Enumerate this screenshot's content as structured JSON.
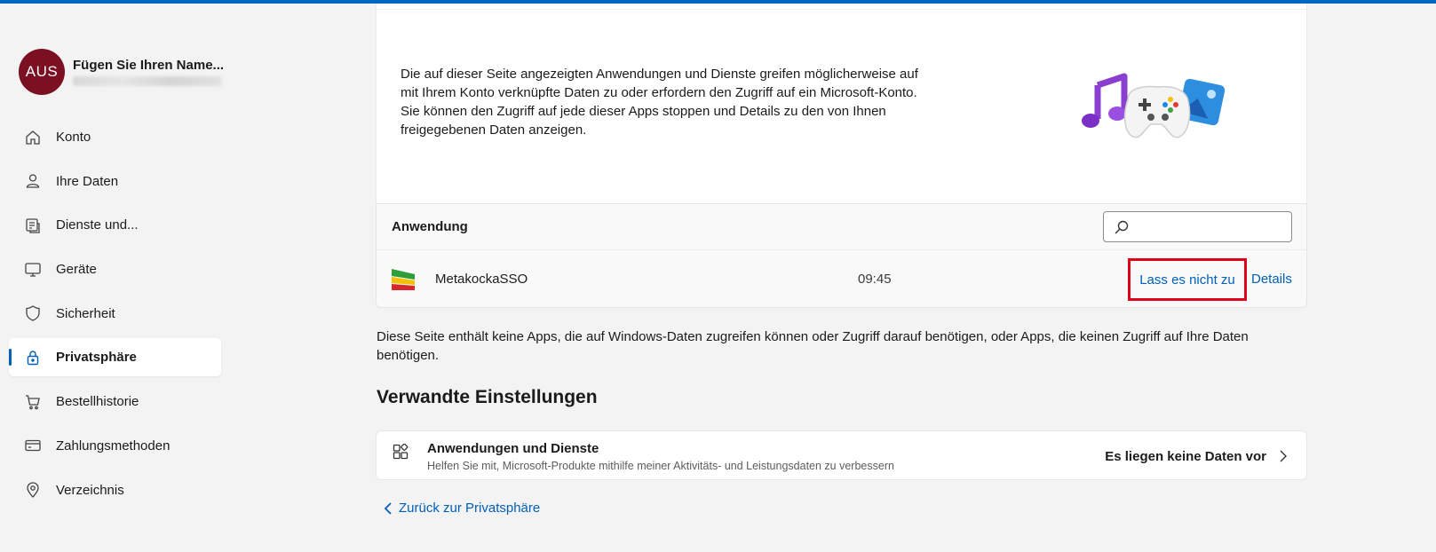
{
  "profile": {
    "initials": "AUS",
    "name": "Fügen Sie Ihren Name..."
  },
  "sidebar": {
    "items": [
      {
        "label": "Konto",
        "icon": "home-icon"
      },
      {
        "label": "Ihre Daten",
        "icon": "person-icon"
      },
      {
        "label": "Dienste und...",
        "icon": "services-icon"
      },
      {
        "label": "Geräte",
        "icon": "monitor-icon"
      },
      {
        "label": "Sicherheit",
        "icon": "shield-icon"
      },
      {
        "label": "Privatsphäre",
        "icon": "lock-icon",
        "active": true
      },
      {
        "label": "Bestellhistorie",
        "icon": "cart-icon"
      },
      {
        "label": "Zahlungsmethoden",
        "icon": "card-icon"
      },
      {
        "label": "Verzeichnis",
        "icon": "location-pin-icon"
      }
    ]
  },
  "main": {
    "intro": "Die auf dieser Seite angezeigten Anwendungen und Dienste greifen möglicherweise auf mit Ihrem Konto verknüpfte Daten zu oder erfordern den Zugriff auf ein Microsoft-Konto. Sie können den Zugriff auf jede dieser Apps stoppen und Details zu den von Ihnen freigegebenen Daten anzeigen.",
    "table": {
      "header": "Anwendung",
      "search_placeholder": "",
      "rows": [
        {
          "name": "MetakockaSSO",
          "time": "09:45",
          "revoke_label": "Lass es nicht zu",
          "details_label": "Details"
        }
      ]
    },
    "note": "Diese Seite enthält keine Apps, die auf Windows-Daten zugreifen können oder Zugriff darauf benötigen, oder Apps, die keinen Zugriff auf Ihre Daten benötigen.",
    "related": {
      "title": "Verwandte Einstellungen",
      "card": {
        "title": "Anwendungen und Dienste",
        "subtitle": "Helfen Sie mit, Microsoft-Produkte mithilfe meiner Aktivitäts- und Leistungsdaten zu verbessern",
        "status": "Es liegen keine Daten vor"
      }
    },
    "back_label": "Zurück zur Privatsphäre"
  },
  "colors": {
    "accent": "#005fb8",
    "avatar": "#7a1022",
    "highlight": "#e0001b"
  }
}
